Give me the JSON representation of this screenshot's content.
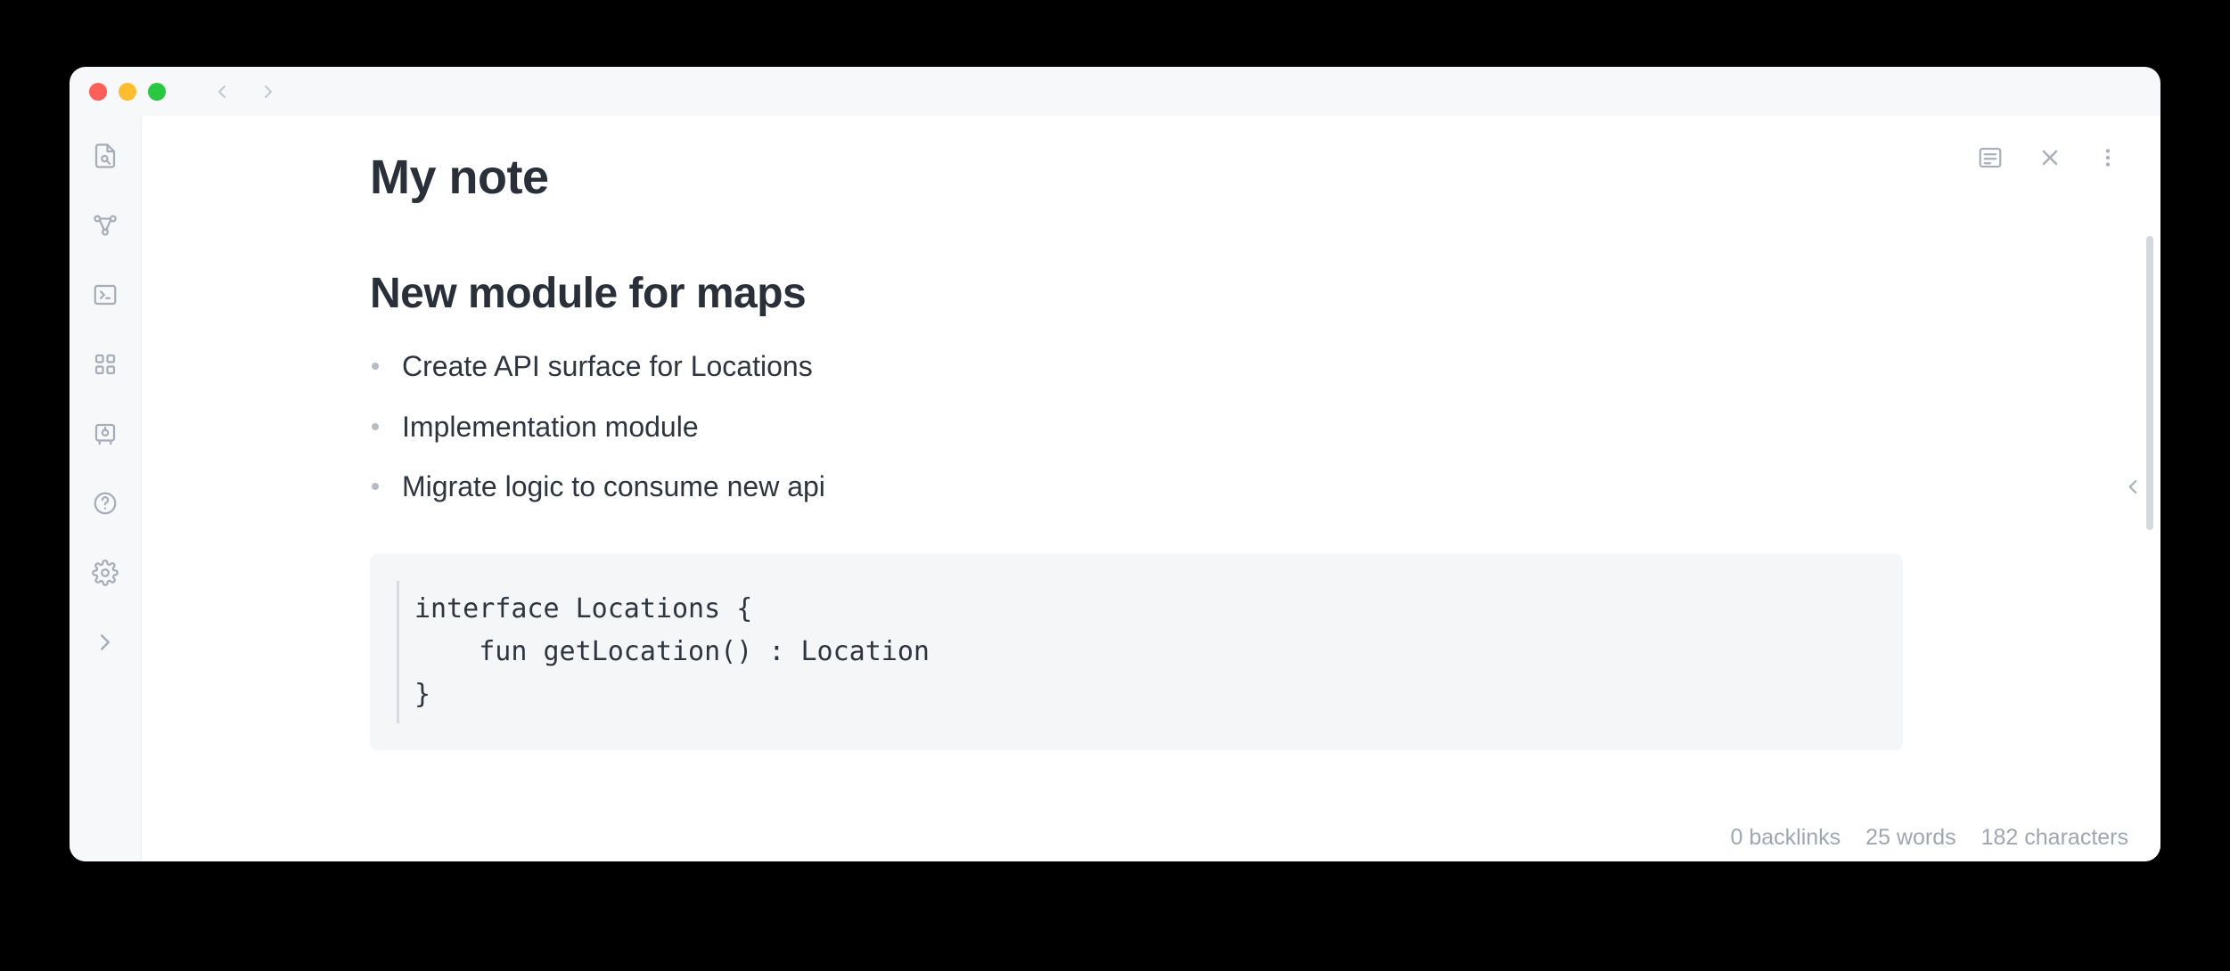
{
  "note": {
    "title": "My note",
    "heading": "New module for maps",
    "bullets": [
      "Create API surface for Locations",
      "Implementation module",
      "Migrate logic to consume new api"
    ],
    "code": "interface Locations {\n    fun getLocation() : Location\n}"
  },
  "status": {
    "backlinks": "0 backlinks",
    "words": "25 words",
    "characters": "182 characters"
  },
  "sidebar": {
    "items": [
      {
        "name": "search-file-icon"
      },
      {
        "name": "graph-icon"
      },
      {
        "name": "terminal-icon"
      },
      {
        "name": "apps-grid-icon"
      },
      {
        "name": "vault-icon"
      },
      {
        "name": "help-icon"
      },
      {
        "name": "settings-icon"
      },
      {
        "name": "expand-icon"
      }
    ]
  },
  "icons": {
    "preview": "preview-icon",
    "close": "close-icon",
    "more": "more-icon"
  }
}
